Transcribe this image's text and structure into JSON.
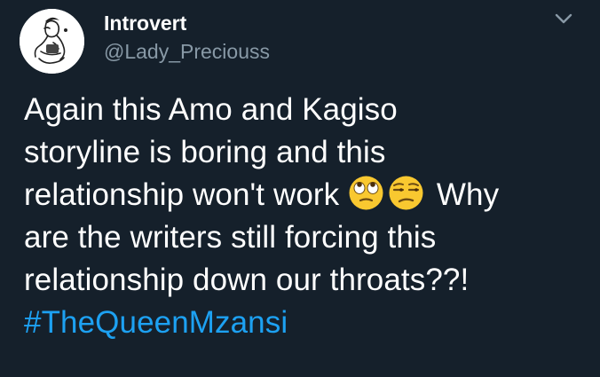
{
  "tweet": {
    "display_name": "Introvert",
    "handle": "@Lady_Preciouss",
    "text_lines": [
      "Again this Amo and Kagiso",
      "storyline is boring and this",
      "relationship won't work",
      "Why",
      "are the writers still forcing this",
      "relationship down our throats??!"
    ],
    "hashtag": "#TheQueenMzansi",
    "emojis": [
      "face-with-rolling-eyes-emoji",
      "unamused-face-emoji"
    ]
  },
  "colors": {
    "background": "#15202b",
    "text": "#ffffff",
    "secondary_text": "#8899a6",
    "link": "#1da1f2",
    "emoji_yellow": "#f9c830"
  },
  "icons": {
    "caret": "chevron-down-icon",
    "avatar": "avatar"
  }
}
